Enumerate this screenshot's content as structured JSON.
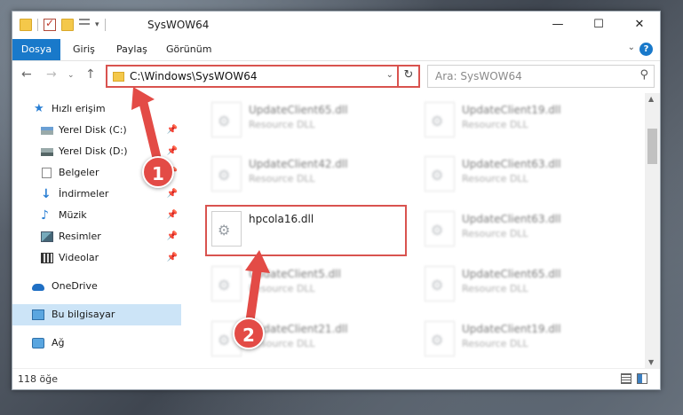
{
  "window": {
    "title": "SysWOW64",
    "controls": {
      "minimize": "—",
      "maximize": "☐",
      "close": "✕"
    }
  },
  "ribbon": {
    "tabs": [
      "Dosya",
      "Giriş",
      "Paylaş",
      "Görünüm"
    ],
    "help": "?"
  },
  "navigation": {
    "address": "C:\\Windows\\SysWOW64",
    "search_placeholder": "Ara: SysWOW64"
  },
  "sidebar": {
    "items": [
      {
        "label": "Hızlı erişim",
        "icon": "star-icon"
      },
      {
        "label": "Yerel Disk (C:)",
        "icon": "drive-icon",
        "pinned": true
      },
      {
        "label": "Yerel Disk (D:)",
        "icon": "drive-icon",
        "pinned": true
      },
      {
        "label": "Belgeler",
        "icon": "documents-icon",
        "pinned": true
      },
      {
        "label": "İndirmeler",
        "icon": "downloads-icon",
        "pinned": true
      },
      {
        "label": "Müzik",
        "icon": "music-icon",
        "pinned": true
      },
      {
        "label": "Resimler",
        "icon": "pictures-icon",
        "pinned": true
      },
      {
        "label": "Videolar",
        "icon": "videos-icon",
        "pinned": true
      },
      {
        "label": "OneDrive",
        "icon": "onedrive-icon"
      },
      {
        "label": "Bu bilgisayar",
        "icon": "this-pc-icon",
        "selected": true
      },
      {
        "label": "Ağ",
        "icon": "network-icon"
      }
    ]
  },
  "files": {
    "left": [
      {
        "name": "UpdateClient65.dll",
        "type": "Resource DLL",
        "blurred": true
      },
      {
        "name": "UpdateClient42.dll",
        "type": "Resource DLL",
        "blurred": true
      },
      {
        "name": "hpcola16.dll",
        "type": "",
        "blurred": false,
        "highlighted": true
      },
      {
        "name": "UpdateClient5.dll",
        "type": "Resource DLL",
        "blurred": true
      },
      {
        "name": "UpdateClient21.dll",
        "type": "Resource DLL",
        "blurred": true
      }
    ],
    "right": [
      {
        "name": "UpdateClient19.dll",
        "type": "Resource DLL",
        "blurred": true
      },
      {
        "name": "UpdateClient63.dll",
        "type": "Resource DLL",
        "blurred": true
      },
      {
        "name": "UpdateClient63.dll",
        "type": "Resource DLL",
        "blurred": true
      },
      {
        "name": "UpdateClient65.dll",
        "type": "Resource DLL",
        "blurred": true
      },
      {
        "name": "UpdateClient19.dll",
        "type": "Resource DLL",
        "blurred": true
      }
    ]
  },
  "status": {
    "item_count": "118 öğe"
  },
  "annotations": {
    "step1": "1",
    "step2": "2",
    "color": "#e34b46"
  }
}
